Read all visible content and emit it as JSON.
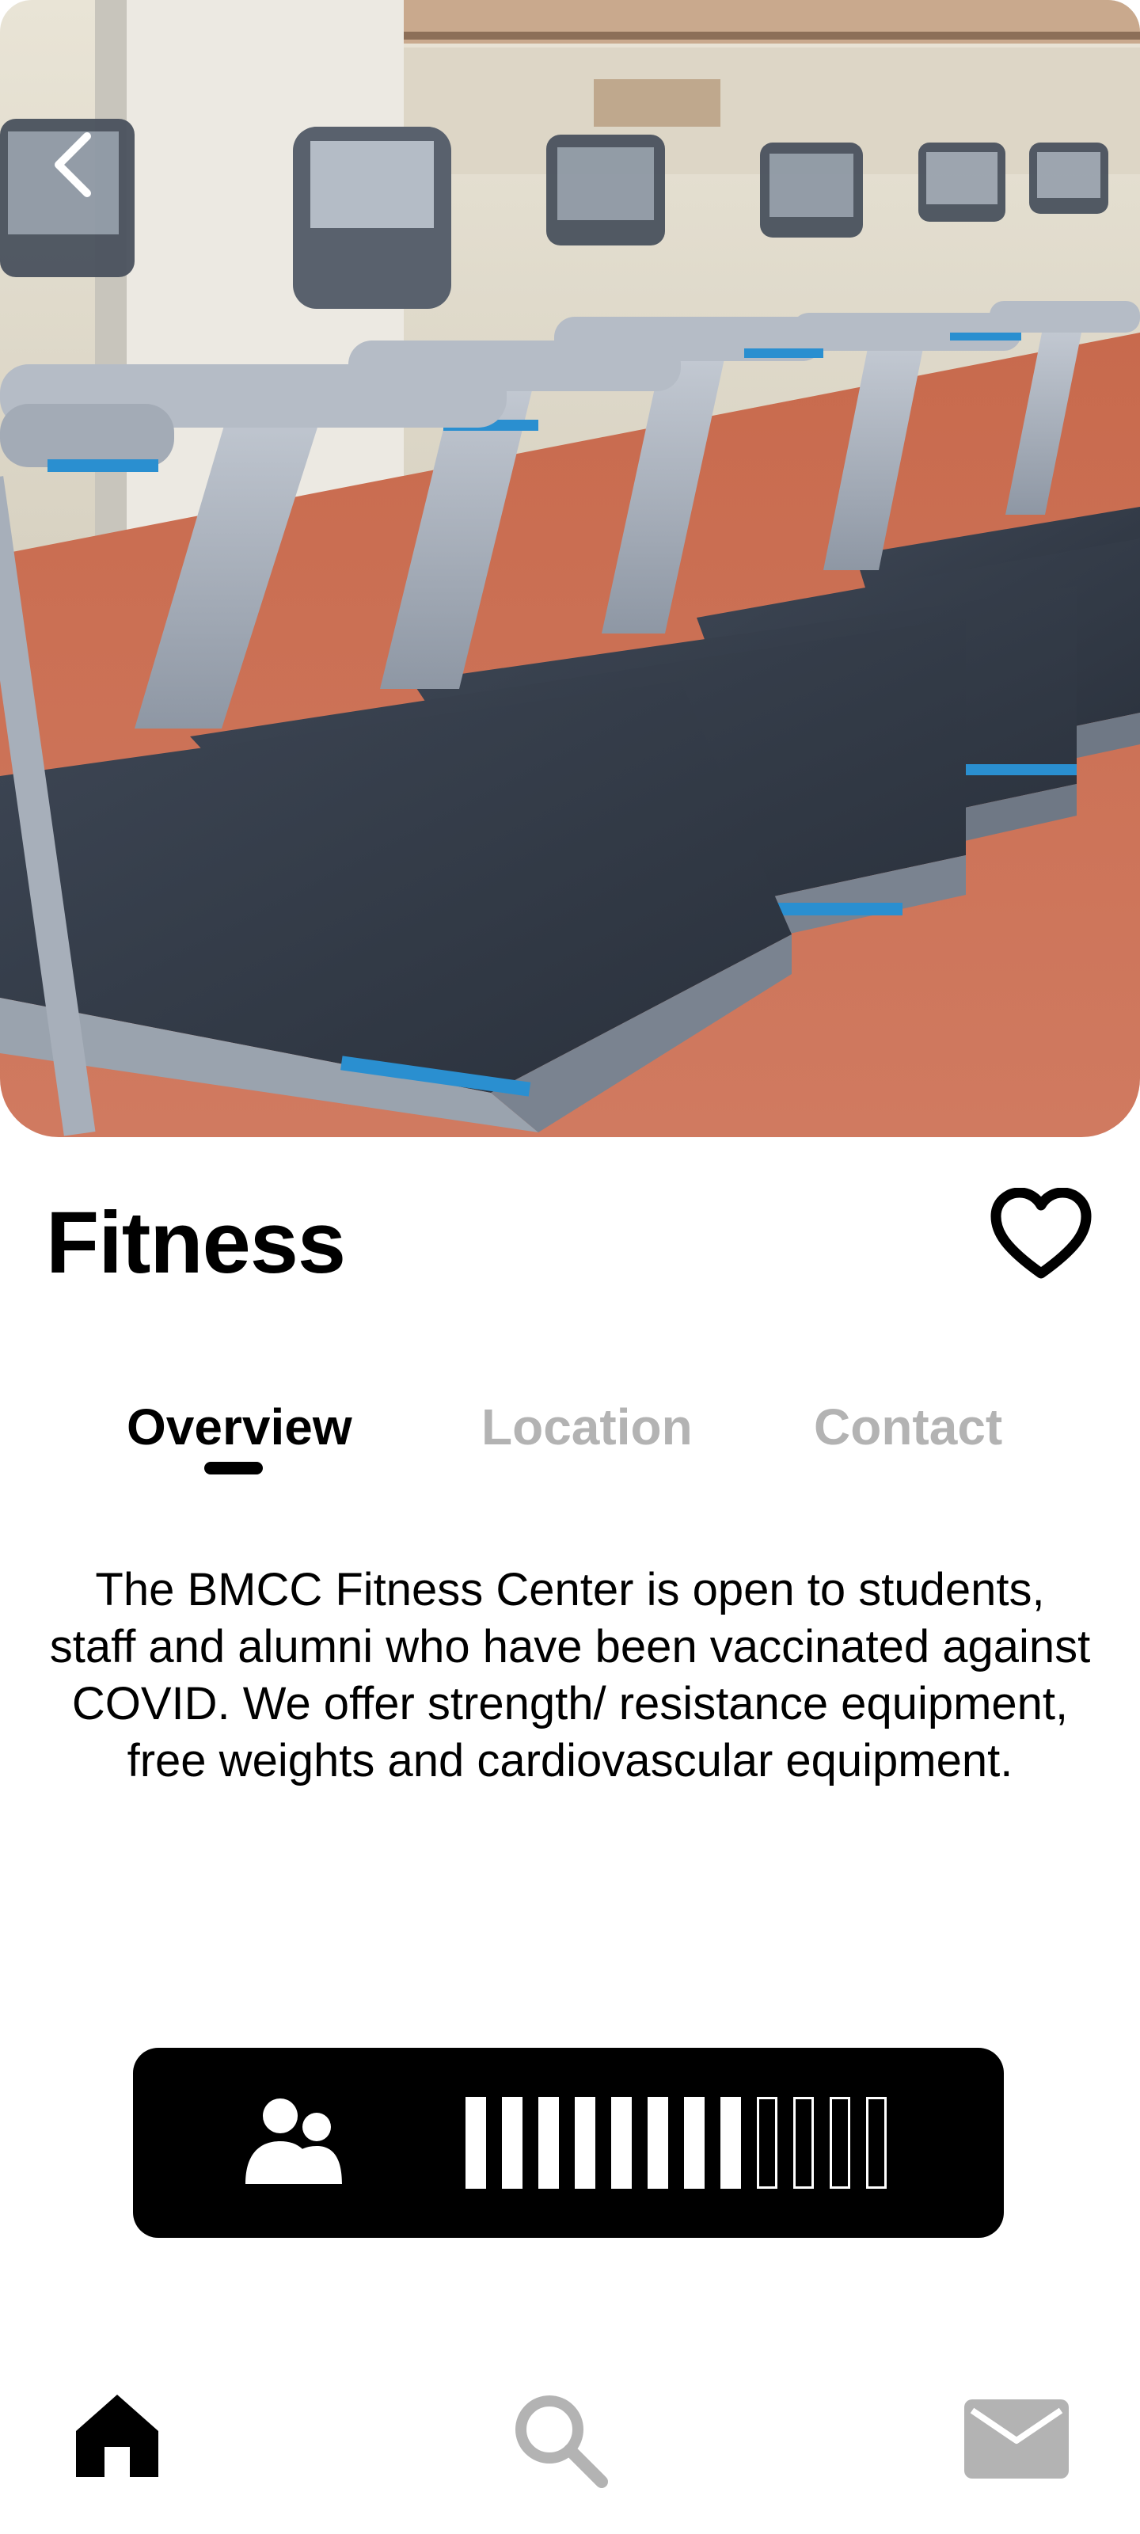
{
  "header": {
    "title": "Fitness"
  },
  "hero": {
    "image": "gym-treadmills-photo",
    "back_icon": "chevron-left-icon"
  },
  "favorite": {
    "icon": "heart-outline-icon"
  },
  "tabs": [
    {
      "label": "Overview",
      "active": true
    },
    {
      "label": "Location",
      "active": false
    },
    {
      "label": "Contact",
      "active": false
    }
  ],
  "overview": {
    "description": "The BMCC Fitness Center is open to students, staff and alumni who have been vaccinated against COVID. We offer strength/ resistance equipment, free weights and cardiovascular equipment."
  },
  "occupancy": {
    "icon": "people-icon",
    "filled_segments": 8,
    "total_segments": 12
  },
  "bottom_nav": [
    {
      "icon": "home-icon",
      "active": true
    },
    {
      "icon": "search-icon",
      "active": false
    },
    {
      "icon": "mail-icon",
      "active": false
    }
  ],
  "colors": {
    "active": "#000000",
    "inactive": "#b3b3b3",
    "background": "#ffffff",
    "floor": "#c8745a",
    "treadmill_accent": "#2a8fd0"
  }
}
